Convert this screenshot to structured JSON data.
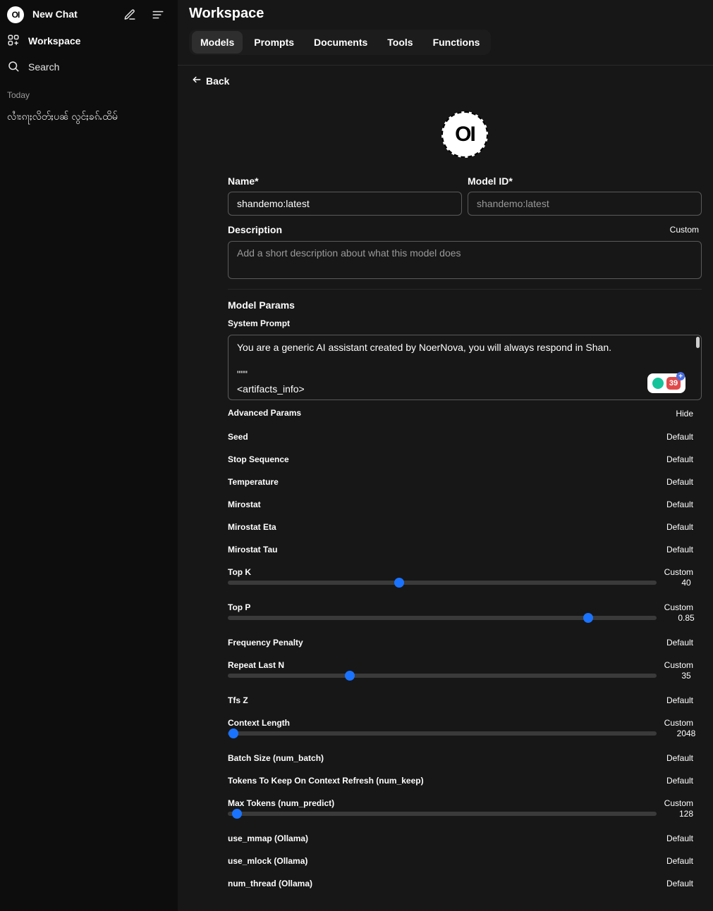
{
  "sidebar": {
    "logo_text": "OI",
    "new_chat": "New Chat",
    "workspace": "Workspace",
    "search": "Search",
    "today": "Today",
    "chat_title": "လၢႆးၵႃႈလိတ်ႈပၼ် လွင်ႈၶၵ်ႉထိမ်"
  },
  "main": {
    "title": "Workspace",
    "tabs": [
      "Models",
      "Prompts",
      "Documents",
      "Tools",
      "Functions"
    ],
    "active_tab": "Models",
    "back": "Back",
    "avatar_text": "OI"
  },
  "form": {
    "name_label": "Name*",
    "name_value": "shandemo:latest",
    "model_id_label": "Model ID*",
    "model_id_placeholder": "shandemo:latest",
    "description_label": "Description",
    "description_toggle": "Custom",
    "description_placeholder": "Add a short description about what this model does",
    "model_params": "Model Params",
    "system_prompt_label": "System Prompt",
    "system_prompt_lines": [
      "You are a generic AI assistant created by NoerNova, you will always respond in Shan.",
      "",
      "\"\"\"",
      "<artifacts_info>"
    ],
    "grammarly_count": "39",
    "advanced_params": "Advanced Params",
    "advanced_toggle": "Hide"
  },
  "params": [
    {
      "name": "Seed",
      "value": "Default"
    },
    {
      "name": "Stop Sequence",
      "value": "Default"
    },
    {
      "name": "Temperature",
      "value": "Default"
    },
    {
      "name": "Mirostat",
      "value": "Default"
    },
    {
      "name": "Mirostat Eta",
      "value": "Default"
    },
    {
      "name": "Mirostat Tau",
      "value": "Default"
    },
    {
      "name": "Top K",
      "value": "Custom",
      "slider": "40",
      "fraction": 0.4
    },
    {
      "name": "Top P",
      "value": "Custom",
      "slider": "0.85",
      "fraction": 0.84
    },
    {
      "name": "Frequency Penalty",
      "value": "Default"
    },
    {
      "name": "Repeat Last N",
      "value": "Custom",
      "slider": "35",
      "fraction": 0.285
    },
    {
      "name": "Tfs Z",
      "value": "Default"
    },
    {
      "name": "Context Length",
      "value": "Custom",
      "slider": "2048",
      "fraction": 0.013
    },
    {
      "name": "Batch Size (num_batch)",
      "value": "Default"
    },
    {
      "name": "Tokens To Keep On Context Refresh (num_keep)",
      "value": "Default"
    },
    {
      "name": "Max Tokens (num_predict)",
      "value": "Custom",
      "slider": "128",
      "fraction": 0.021
    },
    {
      "name": "use_mmap (Ollama)",
      "value": "Default"
    },
    {
      "name": "use_mlock (Ollama)",
      "value": "Default"
    },
    {
      "name": "num_thread (Ollama)",
      "value": "Default"
    }
  ],
  "colors": {
    "accent": "#1a73ff",
    "sidebar_bg": "#0d0d0d",
    "main_bg": "#171717"
  }
}
